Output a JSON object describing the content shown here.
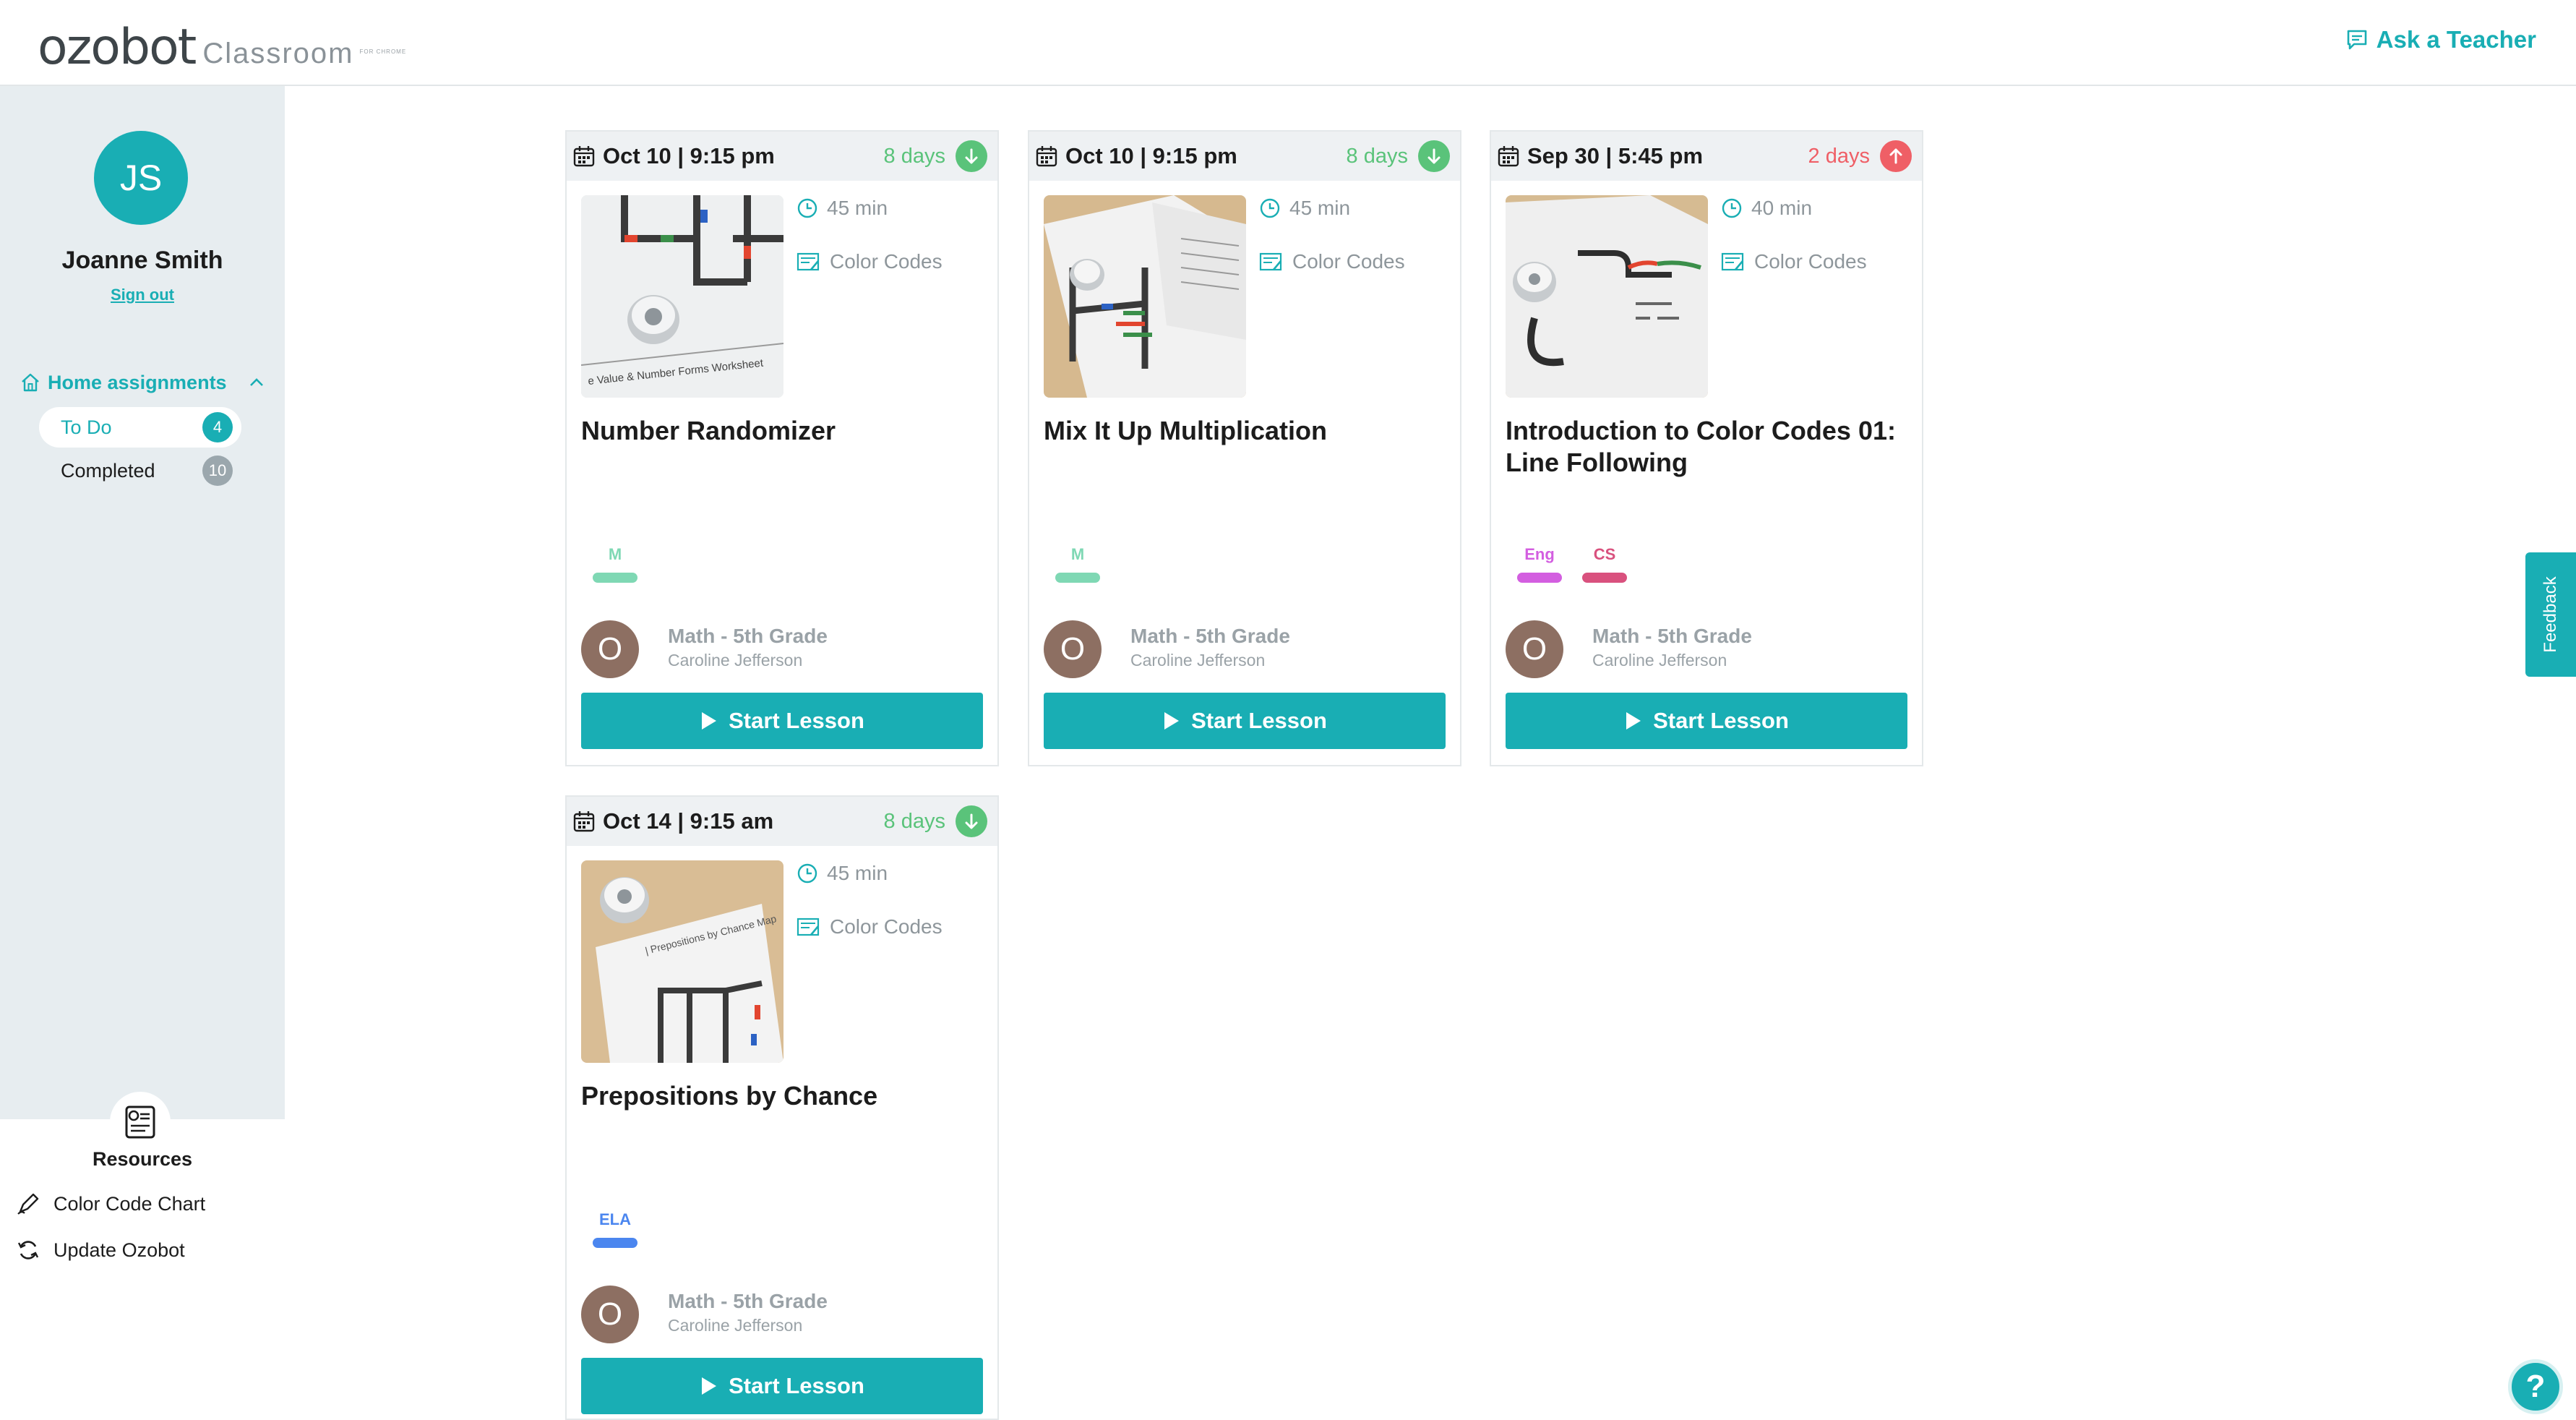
{
  "header": {
    "logo_word": "ozobot",
    "logo_sub": "Classroom",
    "logo_tiny": "FOR CHROME",
    "ask_label": "Ask a Teacher"
  },
  "sidebar": {
    "initials": "JS",
    "user_name": "Joanne Smith",
    "sign_out": "Sign out",
    "section_label": "Home assignments",
    "items": [
      {
        "label": "To Do",
        "count": "4"
      },
      {
        "label": "Completed",
        "count": "10"
      }
    ]
  },
  "resources": {
    "title": "Resources",
    "links": [
      {
        "label": "Color Code Chart"
      },
      {
        "label": "Update Ozobot"
      }
    ]
  },
  "cards": [
    {
      "date": "Oct 10 | 9:15 pm",
      "days": "8 days",
      "status": "green",
      "duration": "45 min",
      "type": "Color Codes",
      "title": "Number Randomizer",
      "tags": [
        {
          "label": "M",
          "color": "#7fd8b4"
        }
      ],
      "teacher_initial": "O",
      "class_name": "Math - 5th Grade",
      "teacher": "Caroline Jefferson",
      "button": "Start Lesson"
    },
    {
      "date": "Oct 10 | 9:15 pm",
      "days": "8 days",
      "status": "green",
      "duration": "45 min",
      "type": "Color Codes",
      "title": "Mix It Up Multiplication",
      "tags": [
        {
          "label": "M",
          "color": "#7fd8b4"
        }
      ],
      "teacher_initial": "O",
      "class_name": "Math - 5th Grade",
      "teacher": "Caroline Jefferson",
      "button": "Start Lesson"
    },
    {
      "date": "Sep 30 | 5:45 pm",
      "days": "2 days",
      "status": "red",
      "duration": "40 min",
      "type": "Color Codes",
      "title": "Introduction to Color Codes 01: Line Following",
      "tags": [
        {
          "label": "Eng",
          "color": "#d35ee0"
        },
        {
          "label": "CS",
          "color": "#d9517e"
        }
      ],
      "teacher_initial": "O",
      "class_name": "Math - 5th Grade",
      "teacher": "Caroline Jefferson",
      "button": "Start Lesson"
    },
    {
      "date": "Oct 14 | 9:15 am",
      "days": "8 days",
      "status": "green",
      "duration": "45 min",
      "type": "Color Codes",
      "title": "Prepositions by Chance",
      "tags": [
        {
          "label": "ELA",
          "color": "#4b86ef"
        }
      ],
      "teacher_initial": "O",
      "class_name": "Math - 5th Grade",
      "teacher": "Caroline Jefferson",
      "button": "Start Lesson"
    }
  ],
  "feedback_label": "Feedback",
  "help_label": "?",
  "colors": {
    "accent": "#19aeb4",
    "green": "#5ac37a",
    "red": "#ef5f66"
  }
}
